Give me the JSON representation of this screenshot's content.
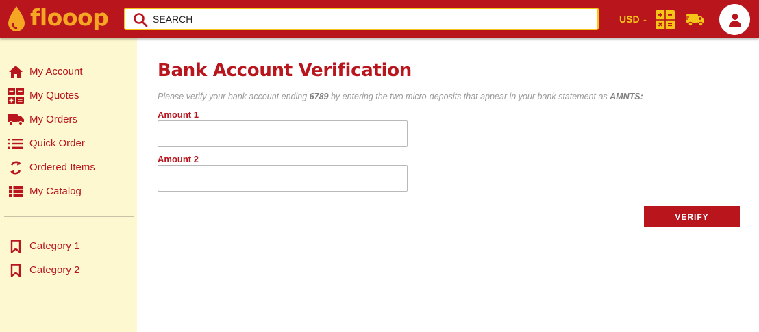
{
  "colors": {
    "brand_red": "#b8151d",
    "brand_orange": "#f5a623",
    "brand_yellow": "#f5c518",
    "sidebar_bg": "#fef8d0"
  },
  "header": {
    "logo_text": "flooop",
    "search_placeholder": "SEARCH",
    "search_value": "",
    "currency": "USD",
    "icons": [
      "droplet-logo-icon",
      "search-icon",
      "calculator-icon",
      "truck-icon",
      "user-icon"
    ]
  },
  "sidebar": {
    "items": [
      {
        "label": "My Account",
        "icon": "home-icon"
      },
      {
        "label": "My Quotes",
        "icon": "calculator-icon"
      },
      {
        "label": "My Orders",
        "icon": "truck-icon"
      },
      {
        "label": "Quick Order",
        "icon": "list-icon"
      },
      {
        "label": "Ordered Items",
        "icon": "refresh-icon"
      },
      {
        "label": "My Catalog",
        "icon": "catalog-list-icon"
      }
    ],
    "categories": [
      {
        "label": "Category 1",
        "icon": "bookmark-icon"
      },
      {
        "label": "Category 2",
        "icon": "bookmark-icon"
      }
    ]
  },
  "main": {
    "title": "Bank Account Verification",
    "instructions": {
      "prefix": "Please verify your bank account ending ",
      "account_ending": "6789",
      "middle": " by entering the two micro-deposits that appear in your bank statement as ",
      "descriptor": "AMNTS:"
    },
    "fields": [
      {
        "label": "Amount 1",
        "value": ""
      },
      {
        "label": "Amount 2",
        "value": ""
      }
    ],
    "verify_label": "VERIFY"
  }
}
